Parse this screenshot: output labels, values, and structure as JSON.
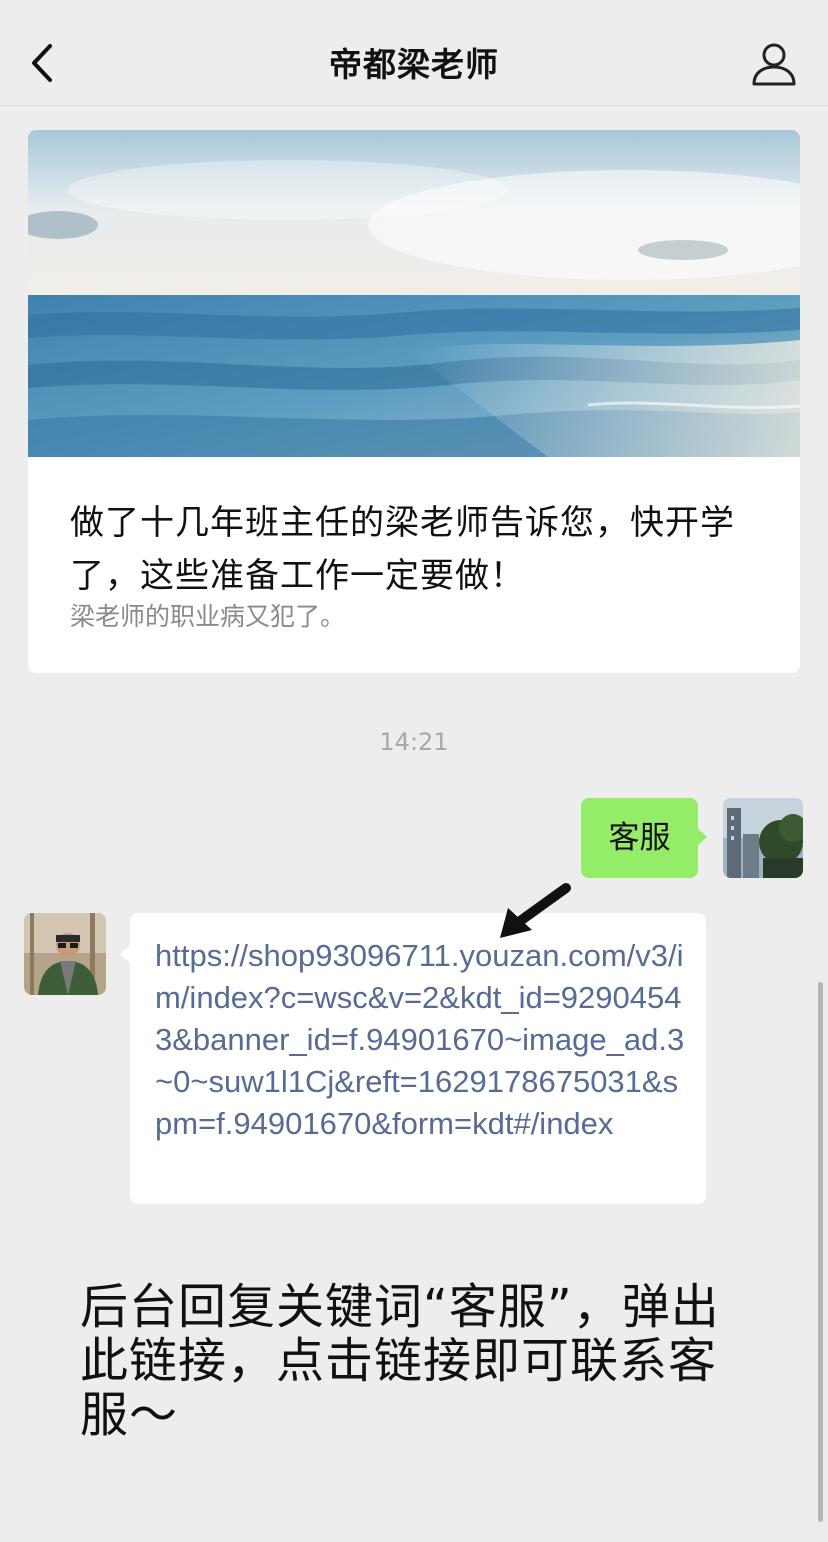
{
  "header": {
    "title": "帝都梁老师",
    "back_icon": "chevron-left-icon",
    "profile_icon": "person-icon"
  },
  "article": {
    "title": "做了十几年班主任的梁老师告诉您，快开学了，这些准备工作一定要做！",
    "description": "梁老师的职业病又犯了。",
    "cover_icon": "ocean-cover-image"
  },
  "chat": {
    "timestamp": "14:21",
    "outgoing": {
      "text": "客服",
      "bubble_color": "#95ec69"
    },
    "incoming": {
      "link": "https://shop93096711.youzan.com/v3/im/index?c=wsc&v=2&kdt_id=92904543&banner_id=f.94901670~image_ad.3~0~suw1l1Cj&reft=1629178675031&spm=f.94901670&form=kdt#/index",
      "link_color": "#576b95"
    }
  },
  "annotation": {
    "text": "后台回复关键词“客服”，弹出此链接，点击链接即可联系客服～",
    "arrow_icon": "pointing-arrow-icon"
  },
  "colors": {
    "background": "#ededed",
    "card": "#ffffff",
    "muted_text": "#8a8a8a"
  }
}
